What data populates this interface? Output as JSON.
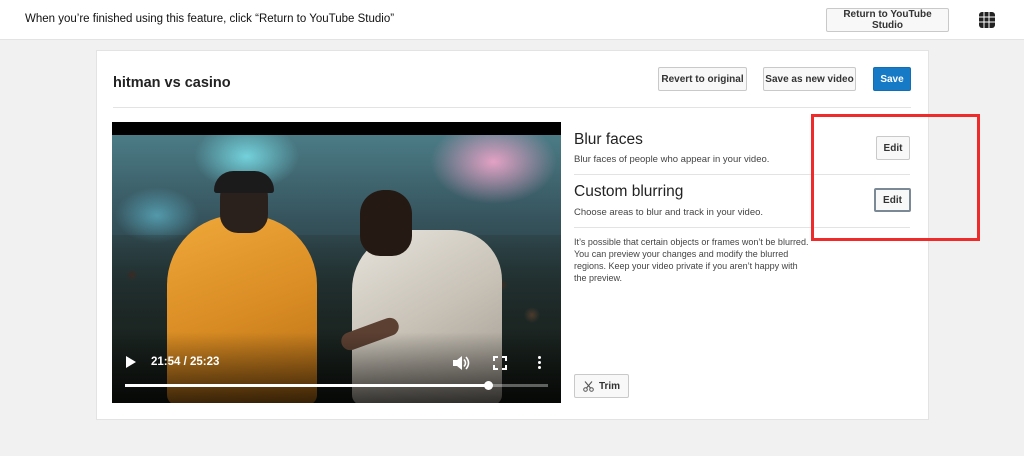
{
  "topbar": {
    "message": "When you’re finished using this feature, click “Return to YouTube Studio”",
    "return_label": "Return to YouTube Studio",
    "logo_icon": "youtube-studio-icon"
  },
  "editor": {
    "video_title": "hitman vs casino",
    "revert_label": "Revert to original",
    "save_as_new_label": "Save as new video",
    "save_label": "Save",
    "save_color": "#167ac6"
  },
  "player": {
    "time": "21:54 / 25:23",
    "progress": 0.86,
    "icons": [
      "play-icon",
      "volume-icon",
      "fullscreen-icon",
      "more-icon"
    ]
  },
  "options": {
    "blur_faces": {
      "title": "Blur faces",
      "description": "Blur faces of people who appear in your video.",
      "edit_label": "Edit"
    },
    "custom_blurring": {
      "title": "Custom blurring",
      "description": "Choose areas to blur and track in your video.",
      "edit_label": "Edit"
    },
    "note": "It’s possible that certain objects or frames won’t be blurred. You can preview your changes and modify the blurred regions. Keep your video private if you aren’t happy with the preview."
  },
  "trim": {
    "label": "Trim",
    "icon": "scissors-icon"
  },
  "annotation": {
    "color": "#ee2a2a"
  }
}
